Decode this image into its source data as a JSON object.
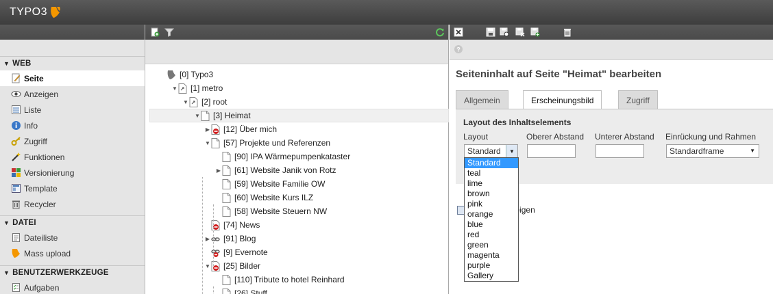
{
  "app": {
    "logo_text": "TYPO3",
    "colors": {
      "logo_orange": "#f49700",
      "accent_blue": "#3399ff"
    }
  },
  "modmenu": {
    "groups": [
      {
        "title": "WEB",
        "items": [
          {
            "label": "Seite",
            "icon": "page-edit-icon",
            "active": true
          },
          {
            "label": "Anzeigen",
            "icon": "eye-icon"
          },
          {
            "label": "Liste",
            "icon": "list-icon"
          },
          {
            "label": "Info",
            "icon": "info-icon"
          },
          {
            "label": "Zugriff",
            "icon": "key-icon"
          },
          {
            "label": "Funktionen",
            "icon": "wand-icon"
          },
          {
            "label": "Versionierung",
            "icon": "versioning-icon"
          },
          {
            "label": "Template",
            "icon": "template-icon"
          },
          {
            "label": "Recycler",
            "icon": "trash-icon"
          }
        ]
      },
      {
        "title": "DATEI",
        "items": [
          {
            "label": "Dateiliste",
            "icon": "file-list-icon"
          },
          {
            "label": "Mass upload",
            "icon": "typo3-icon"
          }
        ]
      },
      {
        "title": "BENUTZERWERKZEUGE",
        "items": [
          {
            "label": "Aufgaben",
            "icon": "tasks-icon"
          }
        ]
      }
    ]
  },
  "tree": {
    "rows": [
      {
        "label": "[0] Typo3",
        "icon": "typo3-root-icon",
        "level": 0,
        "expander": ""
      },
      {
        "label": "[1] metro",
        "icon": "page-shortcut-icon",
        "level": 1,
        "expander": "▼"
      },
      {
        "label": "[2] root",
        "icon": "page-shortcut-icon",
        "level": 2,
        "expander": "▼"
      },
      {
        "label": "[3] Heimat",
        "icon": "page-icon",
        "level": 3,
        "expander": "▼",
        "selected": true
      },
      {
        "label": "[12] Über mich",
        "icon": "page-hidden-icon",
        "level": 4,
        "expander": "▶"
      },
      {
        "label": "[57] Projekte und Referenzen",
        "icon": "page-icon",
        "level": 4,
        "expander": "▼"
      },
      {
        "label": "[90] IPA Wärmepumpenkataster",
        "icon": "page-icon",
        "level": 5,
        "expander": ""
      },
      {
        "label": "[61] Website Janik von Rotz",
        "icon": "page-icon",
        "level": 5,
        "expander": "▶"
      },
      {
        "label": "[59] Website Familie OW",
        "icon": "page-icon",
        "level": 5,
        "expander": ""
      },
      {
        "label": "[60] Website Kurs ILZ",
        "icon": "page-icon",
        "level": 5,
        "expander": ""
      },
      {
        "label": "[58] Website Steuern NW",
        "icon": "page-icon",
        "level": 5,
        "expander": ""
      },
      {
        "label": "[74] News",
        "icon": "page-hidden-icon",
        "level": 4,
        "expander": ""
      },
      {
        "label": "[91] Blog",
        "icon": "link-icon",
        "level": 4,
        "expander": "▶"
      },
      {
        "label": "[9] Evernote",
        "icon": "link-hidden-icon",
        "level": 4,
        "expander": ""
      },
      {
        "label": "[25] Bilder",
        "icon": "page-hidden-icon",
        "level": 4,
        "expander": "▼"
      },
      {
        "label": "[110] Tribute to hotel Reinhard",
        "icon": "page-icon",
        "level": 5,
        "expander": ""
      },
      {
        "label": "[26] Stuff",
        "icon": "page-icon",
        "level": 5,
        "expander": ""
      }
    ]
  },
  "content": {
    "title": "Seiteninhalt auf Seite \"Heimat\" bearbeiten",
    "tabs": [
      "Allgemein",
      "Erscheinungsbild",
      "Zugriff"
    ],
    "active_tab": "Erscheinungsbild",
    "section_title": "Layout des Inhaltselements",
    "fields": {
      "layout_label": "Layout",
      "layout_value": "Standard",
      "oberer_label": "Oberer Abstand",
      "oberer_value": "",
      "unterer_label": "Unterer Abstand",
      "unterer_value": "",
      "einrueckung_label": "Einrückung und Rahmen",
      "einrueckung_value": "Standardframe"
    },
    "dropdown_options": [
      "Standard",
      "teal",
      "lime",
      "brown",
      "pink",
      "orange",
      "blue",
      "red",
      "green",
      "magenta",
      "purple",
      "Gallery"
    ],
    "checkbox_label_visible": "nspalette anzeigen"
  }
}
